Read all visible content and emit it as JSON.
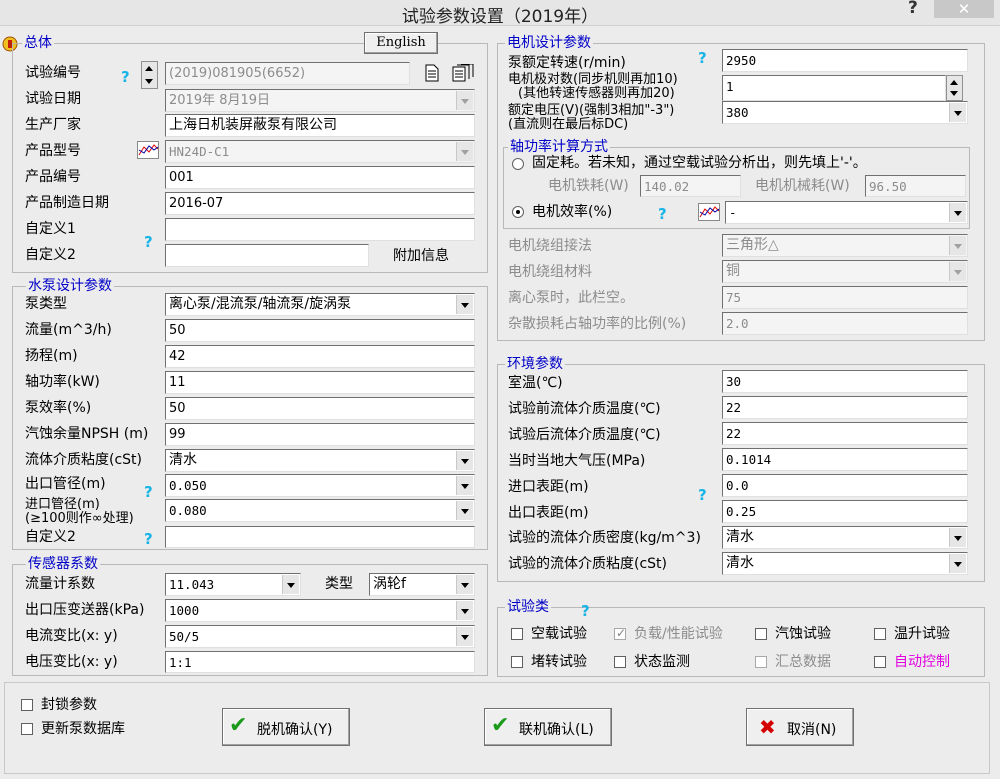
{
  "window": {
    "title": "试验参数设置（2019年）",
    "help": "?",
    "close": "✕"
  },
  "overall": {
    "title": "总体",
    "english_btn": "English",
    "test_no_label": "试验编号",
    "test_no": "(2019)081905(6652)",
    "test_date_label": "试验日期",
    "test_date": "2019年  8月19日",
    "maker_label": "生产厂家",
    "maker": "上海日机装屏蔽泵有限公司",
    "model_label": "产品型号",
    "model": "HN24D-C1",
    "product_no_label": "产品编号",
    "product_no": "001",
    "mfg_date_label": "产品制造日期",
    "mfg_date": "2016-07",
    "custom1_label": "自定义1",
    "custom1": "",
    "custom2_label": "自定义2",
    "custom2": "",
    "extra_btn": "附加信息"
  },
  "pump": {
    "title": "水泵设计参数",
    "type_label": "泵类型",
    "type": "离心泵/混流泵/轴流泵/旋涡泵",
    "flow_label": "流量(m^3/h)",
    "flow": "50",
    "head_label": "扬程(m)",
    "head": "42",
    "shaft_power_label": "轴功率(kW)",
    "shaft_power": "11",
    "efficiency_label": "泵效率(%)",
    "efficiency": "50",
    "npsh_label": "汽蚀余量NPSH (m)",
    "npsh": "99",
    "viscosity_label": "流体介质粘度(cSt)",
    "viscosity": "清水",
    "outlet_label": "出口管径(m)",
    "outlet": "0.050",
    "inlet_label1": "进口管径(m)",
    "inlet_label2": "(≥100则作∞处理)",
    "inlet": "0.080",
    "custom2_label": "自定义2",
    "custom2": ""
  },
  "sensor": {
    "title": "传感器系数",
    "flowmeter_label": "流量计系数",
    "flowmeter": "11.043",
    "type_label": "类型",
    "type": "涡轮f",
    "pressure_label": "出口压变送器(kPa)",
    "pressure": "1000",
    "current_label": "电流变比(x: y)",
    "current": "50/5",
    "voltage_label": "电压变比(x: y)",
    "voltage": "1:1"
  },
  "motor": {
    "title": "电机设计参数",
    "speed_label": "泵额定转速(r/min)",
    "speed": "2950",
    "poles_label1": "电机极对数(同步机则再加10)",
    "poles_label2": "(其他转速传感器则再加20)",
    "poles": "1",
    "voltage_label1": "额定电压(V)(强制3相加\"-3\")",
    "voltage_label2": "(直流则在最后标DC)",
    "voltage": "380"
  },
  "shaft_calc": {
    "title": "轴功率计算方式",
    "fixed_label": "固定耗。若未知，通过空载试验分析出，则先填上'-'。",
    "iron_label": "电机铁耗(W)",
    "iron": "140.02",
    "mech_label": "电机机械耗(W)",
    "mech": "96.50",
    "eff_label": "电机效率(%)",
    "eff": "-",
    "winding_conn_label": "电机绕组接法",
    "winding_conn": "三角形△",
    "winding_mat_label": "电机绕组材料",
    "winding_mat": "铜",
    "centrifugal_label": "离心泵时，此栏空。",
    "centrifugal": "75",
    "stray_label": "杂散损耗占轴功率的比例(%)",
    "stray": "2.0"
  },
  "env": {
    "title": "环境参数",
    "room_label": "室温(℃)",
    "room": "30",
    "before_label": "试验前流体介质温度(℃)",
    "before": "22",
    "after_label": "试验后流体介质温度(℃)",
    "after": "22",
    "atm_label": "当时当地大气压(MPa)",
    "atm": "0.1014",
    "inlet_label": "进口表距(m)",
    "inlet": "0.0",
    "outlet_label": "出口表距(m)",
    "outlet": "0.25",
    "density_label": "试验的流体介质密度(kg/m^3)",
    "density": "清水",
    "viscosity_label": "试验的流体介质粘度(cSt)",
    "viscosity": "清水"
  },
  "test_types": {
    "title": "试验类",
    "noload": "空载试验",
    "load": "负载/性能试验",
    "cavitation": "汽蚀试验",
    "temp": "温升试验",
    "locked": "堵转试验",
    "monitor": "状态监测",
    "summary": "汇总数据",
    "auto": "自动控制"
  },
  "bottom": {
    "lock_label": "封锁参数",
    "update_label": "更新泵数据库",
    "offline_btn": "脱机确认(Y)",
    "online_btn": "联机确认(L)",
    "cancel_btn": "取消(N)"
  },
  "colors": {
    "group_title": "#0000c8",
    "help_icon": "#18b4e6",
    "auto_control": "#e000e0"
  }
}
